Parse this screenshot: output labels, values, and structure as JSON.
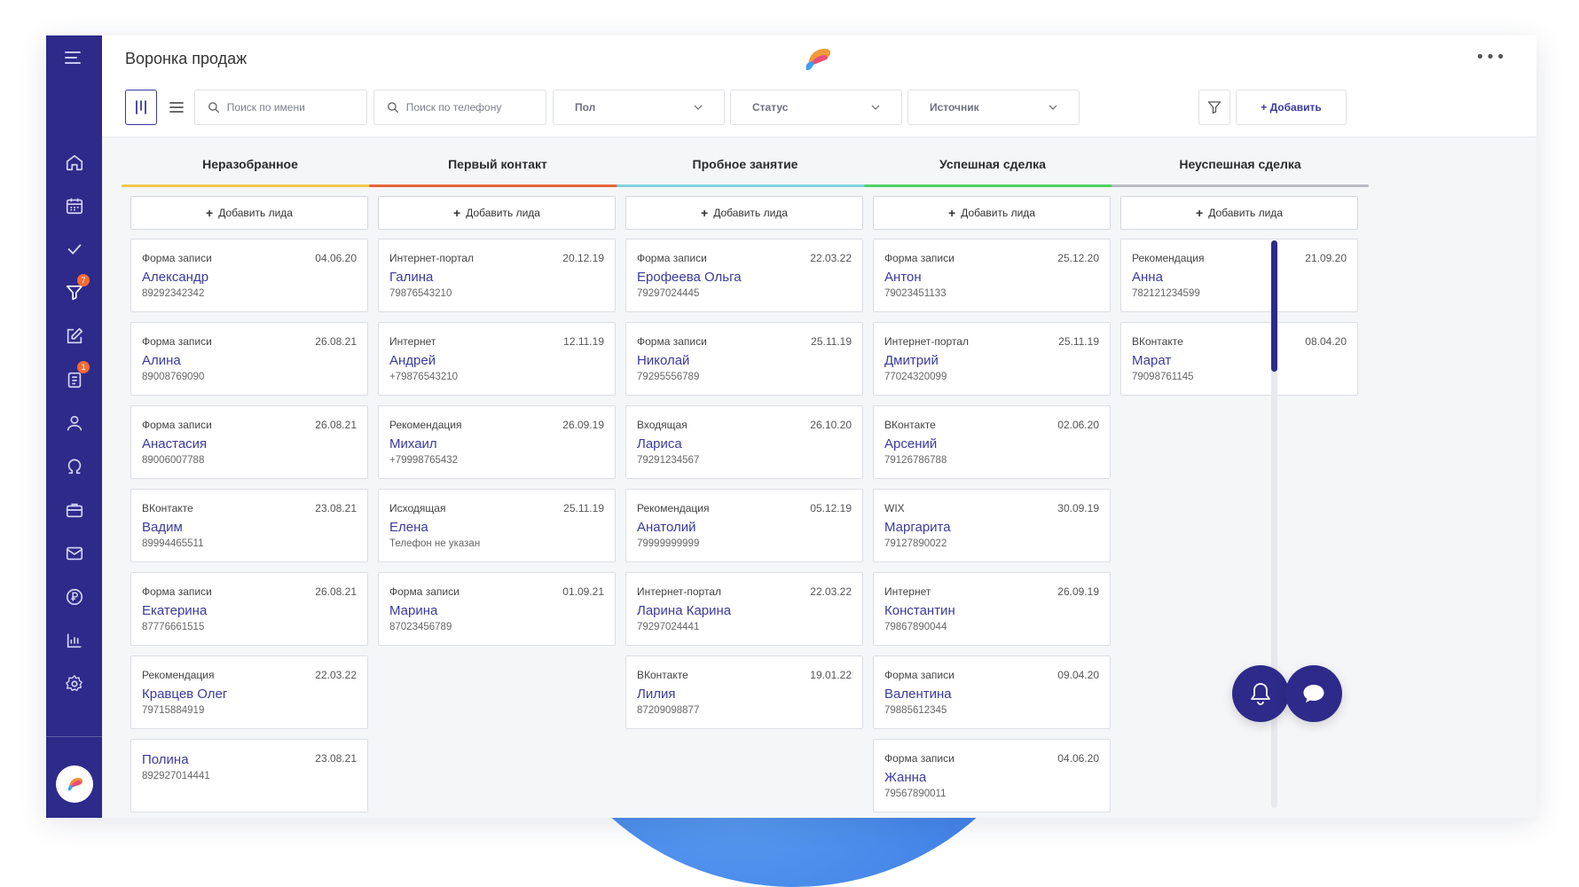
{
  "page": {
    "title": "Воронка продаж"
  },
  "toolbar": {
    "search_name_placeholder": "Поиск по имени",
    "search_phone_placeholder": "Поиск по телефону",
    "gender_label": "Пол",
    "status_label": "Статус",
    "source_label": "Источник",
    "add_label": "+ Добавить"
  },
  "sidebar": {
    "items": [
      {
        "icon": "home-icon"
      },
      {
        "icon": "calendar-icon"
      },
      {
        "icon": "check-icon"
      },
      {
        "icon": "funnel-icon",
        "badge": "7"
      },
      {
        "icon": "edit-icon"
      },
      {
        "icon": "clipboard-icon",
        "badge": "1"
      },
      {
        "icon": "user-icon"
      },
      {
        "icon": "omega-icon"
      },
      {
        "icon": "briefcase-icon"
      },
      {
        "icon": "mail-icon"
      },
      {
        "icon": "ruble-icon"
      },
      {
        "icon": "chart-icon"
      },
      {
        "icon": "settings-icon"
      }
    ]
  },
  "board": {
    "add_lead_label": "Добавить лида",
    "columns": [
      {
        "title": "Неразобранное",
        "color": "#f2c94c",
        "cards": [
          {
            "source": "Форма записи",
            "date": "04.06.20",
            "name": "Александр",
            "phone": "89292342342"
          },
          {
            "source": "Форма записи",
            "date": "26.08.21",
            "name": "Алина",
            "phone": "89008769090"
          },
          {
            "source": "Форма записи",
            "date": "26.08.21",
            "name": "Анастасия",
            "phone": "89006007788"
          },
          {
            "source": "ВКонтакте",
            "date": "23.08.21",
            "name": "Вадим",
            "phone": "89994465511"
          },
          {
            "source": "Форма записи",
            "date": "26.08.21",
            "name": "Екатерина",
            "phone": "87776661515"
          },
          {
            "source": "Рекомендация",
            "date": "22.03.22",
            "name": "Кравцев Олег",
            "phone": "79715884919"
          },
          {
            "source": "",
            "date": "23.08.21",
            "name": "Полина",
            "phone": "892927014441"
          }
        ]
      },
      {
        "title": "Первый контакт",
        "color": "#e8643c",
        "cards": [
          {
            "source": "Интернет-портал",
            "date": "20.12.19",
            "name": "Галина",
            "phone": "79876543210"
          },
          {
            "source": "Интернет",
            "date": "12.11.19",
            "name": "Андрей",
            "phone": "+79876543210"
          },
          {
            "source": "Рекомендация",
            "date": "26.09.19",
            "name": "Михаил",
            "phone": "+79998765432"
          },
          {
            "source": "Исходящая",
            "date": "25.11.19",
            "name": "Елена",
            "phone": "Телефон не указан"
          },
          {
            "source": "Форма записи",
            "date": "01.09.21",
            "name": "Марина",
            "phone": "87023456789"
          }
        ]
      },
      {
        "title": "Пробное занятие",
        "color": "#7fd4e3",
        "cards": [
          {
            "source": "Форма записи",
            "date": "22.03.22",
            "name": "Ерофеева Ольга",
            "phone": "79297024445"
          },
          {
            "source": "Форма записи",
            "date": "25.11.19",
            "name": "Николай",
            "phone": "79295556789"
          },
          {
            "source": "Входящая",
            "date": "26.10.20",
            "name": "Лариса",
            "phone": "79291234567"
          },
          {
            "source": "Рекомендация",
            "date": "05.12.19",
            "name": "Анатолий",
            "phone": "79999999999"
          },
          {
            "source": "Интернет-портал",
            "date": "22.03.22",
            "name": "Ларина Карина",
            "phone": "79297024441"
          },
          {
            "source": "ВКонтакте",
            "date": "19.01.22",
            "name": "Лилия",
            "phone": "87209098877"
          }
        ]
      },
      {
        "title": "Успешная сделка",
        "color": "#4ed264",
        "cards": [
          {
            "source": "Форма записи",
            "date": "25.12.20",
            "name": "Антон",
            "phone": "79023451133"
          },
          {
            "source": "Интернет-портал",
            "date": "25.11.19",
            "name": "Дмитрий",
            "phone": "77024320099"
          },
          {
            "source": "ВКонтакте",
            "date": "02.06.20",
            "name": "Арсений",
            "phone": "79126786788"
          },
          {
            "source": "WIX",
            "date": "30.09.19",
            "name": "Маргарита",
            "phone": "79127890022"
          },
          {
            "source": "Интернет",
            "date": "26.09.19",
            "name": "Константин",
            "phone": "79867890044"
          },
          {
            "source": "Форма записи",
            "date": "09.04.20",
            "name": "Валентина",
            "phone": "79885612345"
          },
          {
            "source": "Форма записи",
            "date": "04.06.20",
            "name": "Жанна",
            "phone": "79567890011"
          }
        ]
      },
      {
        "title": "Неуспешная сделка",
        "color": "#b9bcc4",
        "cards": [
          {
            "source": "Рекомендация",
            "date": "21.09.20",
            "name": "Анна",
            "phone": "782121234599"
          },
          {
            "source": "ВКонтакте",
            "date": "08.04.20",
            "name": "Марат",
            "phone": "79098761145"
          }
        ]
      }
    ]
  }
}
